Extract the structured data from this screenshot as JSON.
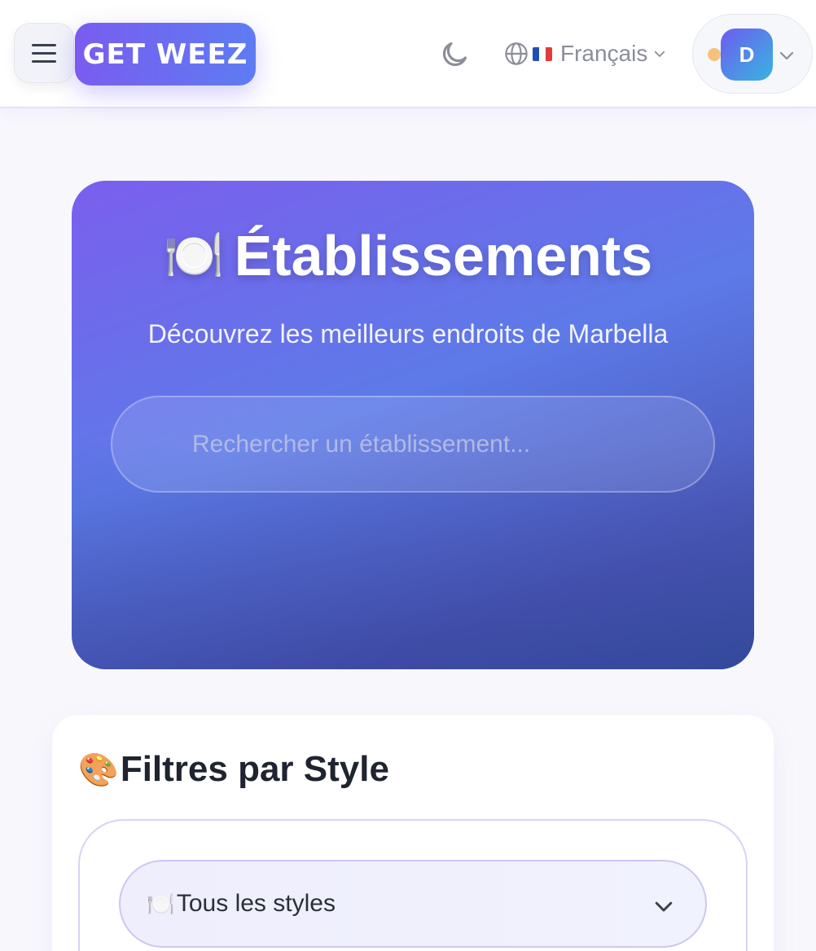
{
  "header": {
    "logo_text": "GET WEEZ",
    "language": {
      "label": "Français",
      "flag_colors": [
        "#1f4fb3",
        "#ffffff",
        "#e23b3b"
      ]
    },
    "user": {
      "initial": "D",
      "status_color": "#f4c27e"
    }
  },
  "hero": {
    "emoji": "🍽️",
    "title": "Établissements",
    "subtitle": "Découvrez les meilleurs endroits de Marbella",
    "search_placeholder": "Rechercher un établissement..."
  },
  "filters": {
    "emoji": "🎨",
    "title": "Filtres par Style",
    "select": {
      "emoji": "🍽️",
      "value": "Tous les styles"
    }
  },
  "colors": {
    "accent": "#7a5cf0",
    "accent_secondary": "#5d7cf2",
    "text_dark": "#1f2430",
    "muted": "#8b8e98"
  }
}
